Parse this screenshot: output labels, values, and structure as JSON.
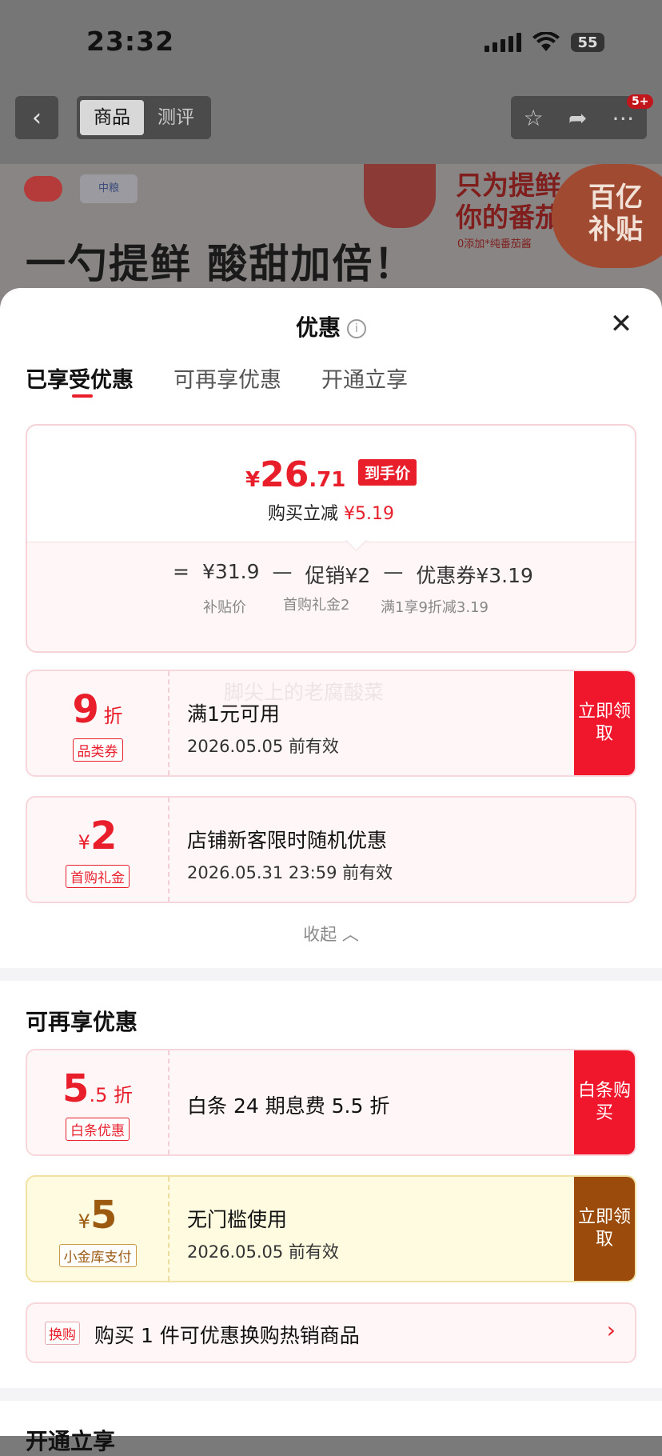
{
  "status": {
    "time": "23:32",
    "battery": "55"
  },
  "header": {
    "back_icon": "chevron-left-icon",
    "tabs": [
      {
        "label": "商品"
      },
      {
        "label": "测评"
      }
    ],
    "badge": "5+",
    "banner": {
      "brand": "中粮",
      "slogan": "一勺提鲜 酸甜加倍！",
      "headline_1": "只为提鲜",
      "headline_2": "你的番茄",
      "small": "0添加*纯番茄酱",
      "subsidy_1": "百亿",
      "subsidy_2": "补贴"
    }
  },
  "sheet": {
    "title": "优惠",
    "tabs": [
      {
        "label": "已享受优惠"
      },
      {
        "label": "可再享优惠"
      },
      {
        "label": "开通立享"
      }
    ],
    "price_card": {
      "yen": "¥",
      "price_int": "26",
      "price_dec": ".71",
      "tag": "到手价",
      "reduce_label": "购买立减",
      "reduce_value": "¥5.19",
      "formula": {
        "eq": "=",
        "base": "¥31.9",
        "minus1": "—",
        "promo": "促销¥2",
        "minus2": "—",
        "coupon": "优惠券¥3.19"
      },
      "base_label": "补贴价",
      "promo_label": "首购礼金2",
      "coupon_label": "满1享9折减3.19"
    },
    "watermark": "脚尖上的老腐酸菜",
    "coupons": [
      {
        "amount": "9",
        "unit": "折",
        "tag": "品类券",
        "title": "满1元可用",
        "date": "2026.05.05 前有效",
        "button": "立即领取"
      },
      {
        "prefix": "¥",
        "amount": "2",
        "tag": "首购礼金",
        "title": "店铺新客限时随机优惠",
        "date": "2026.05.31 23:59 前有效"
      }
    ],
    "collapse": "收起",
    "section2_title": "可再享优惠",
    "coupons2": [
      {
        "amount": "5",
        "unit": ".5 折",
        "tag": "白条优惠",
        "title": "白条 24 期息费 5.5 折",
        "button": "白条购买"
      },
      {
        "prefix": "¥",
        "amount": "5",
        "tag": "小金库支付",
        "title": "无门槛使用",
        "date": "2026.05.05 前有效",
        "button": "立即领取"
      }
    ],
    "swap": {
      "tag": "换购",
      "text": "购买 1 件可优惠换购热销商品"
    },
    "section3_title": "开通立享"
  },
  "colors": {
    "accent": "#e81e2b",
    "gold": "#9b4c0c"
  }
}
